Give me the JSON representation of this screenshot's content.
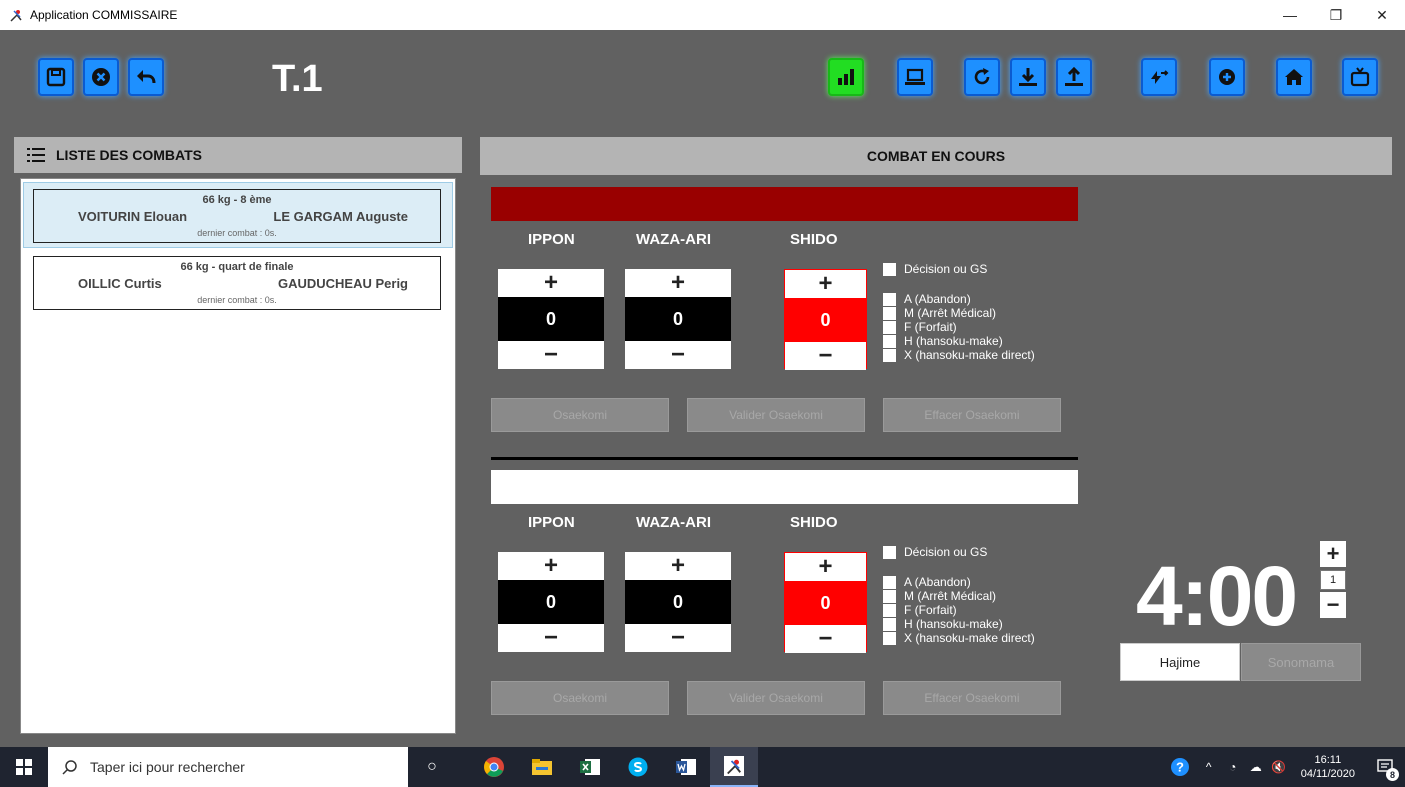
{
  "window": {
    "title": "Application COMMISSAIRE"
  },
  "toolbar": {
    "court": "T.1"
  },
  "left": {
    "header": "LISTE DES COMBATS",
    "fights": [
      {
        "category": "66 kg - 8 ème",
        "p1": "VOITURIN Elouan",
        "p2": "LE GARGAM Auguste",
        "last": "dernier combat : 0s."
      },
      {
        "category": "66 kg - quart de finale",
        "p1": "OILLIC Curtis",
        "p2": "GAUDUCHEAU Perig",
        "last": "dernier combat : 0s."
      }
    ]
  },
  "right": {
    "header": "COMBAT EN COURS"
  },
  "labels": {
    "ippon": "IPPON",
    "waza": "WAZA-ARI",
    "shido": "SHIDO",
    "plus": "+",
    "minus": "−"
  },
  "red": {
    "ippon": "0",
    "waza": "0",
    "shido": "0"
  },
  "white": {
    "ippon": "0",
    "waza": "0",
    "shido": "0"
  },
  "checks": [
    "Décision ou GS",
    "A (Abandon)",
    "M (Arrêt Médical)",
    "F (Forfait)",
    "H (hansoku-make)",
    "X (hansoku-make direct)"
  ],
  "buttons": {
    "osaekomi": "Osaekomi",
    "valider": "Valider Osaekomi",
    "effacer": "Effacer Osaekomi"
  },
  "timer": {
    "value": "4:00",
    "step": "1",
    "hajime": "Hajime",
    "sonomama": "Sonomama"
  },
  "taskbar": {
    "search": "Taper ici pour rechercher",
    "time": "16:11",
    "date": "04/11/2020",
    "notif": "8"
  },
  "colors": {
    "accent": "#1e90ff",
    "red_bar": "#990000",
    "shido": "#ff0000",
    "stats": "#22dd22"
  }
}
